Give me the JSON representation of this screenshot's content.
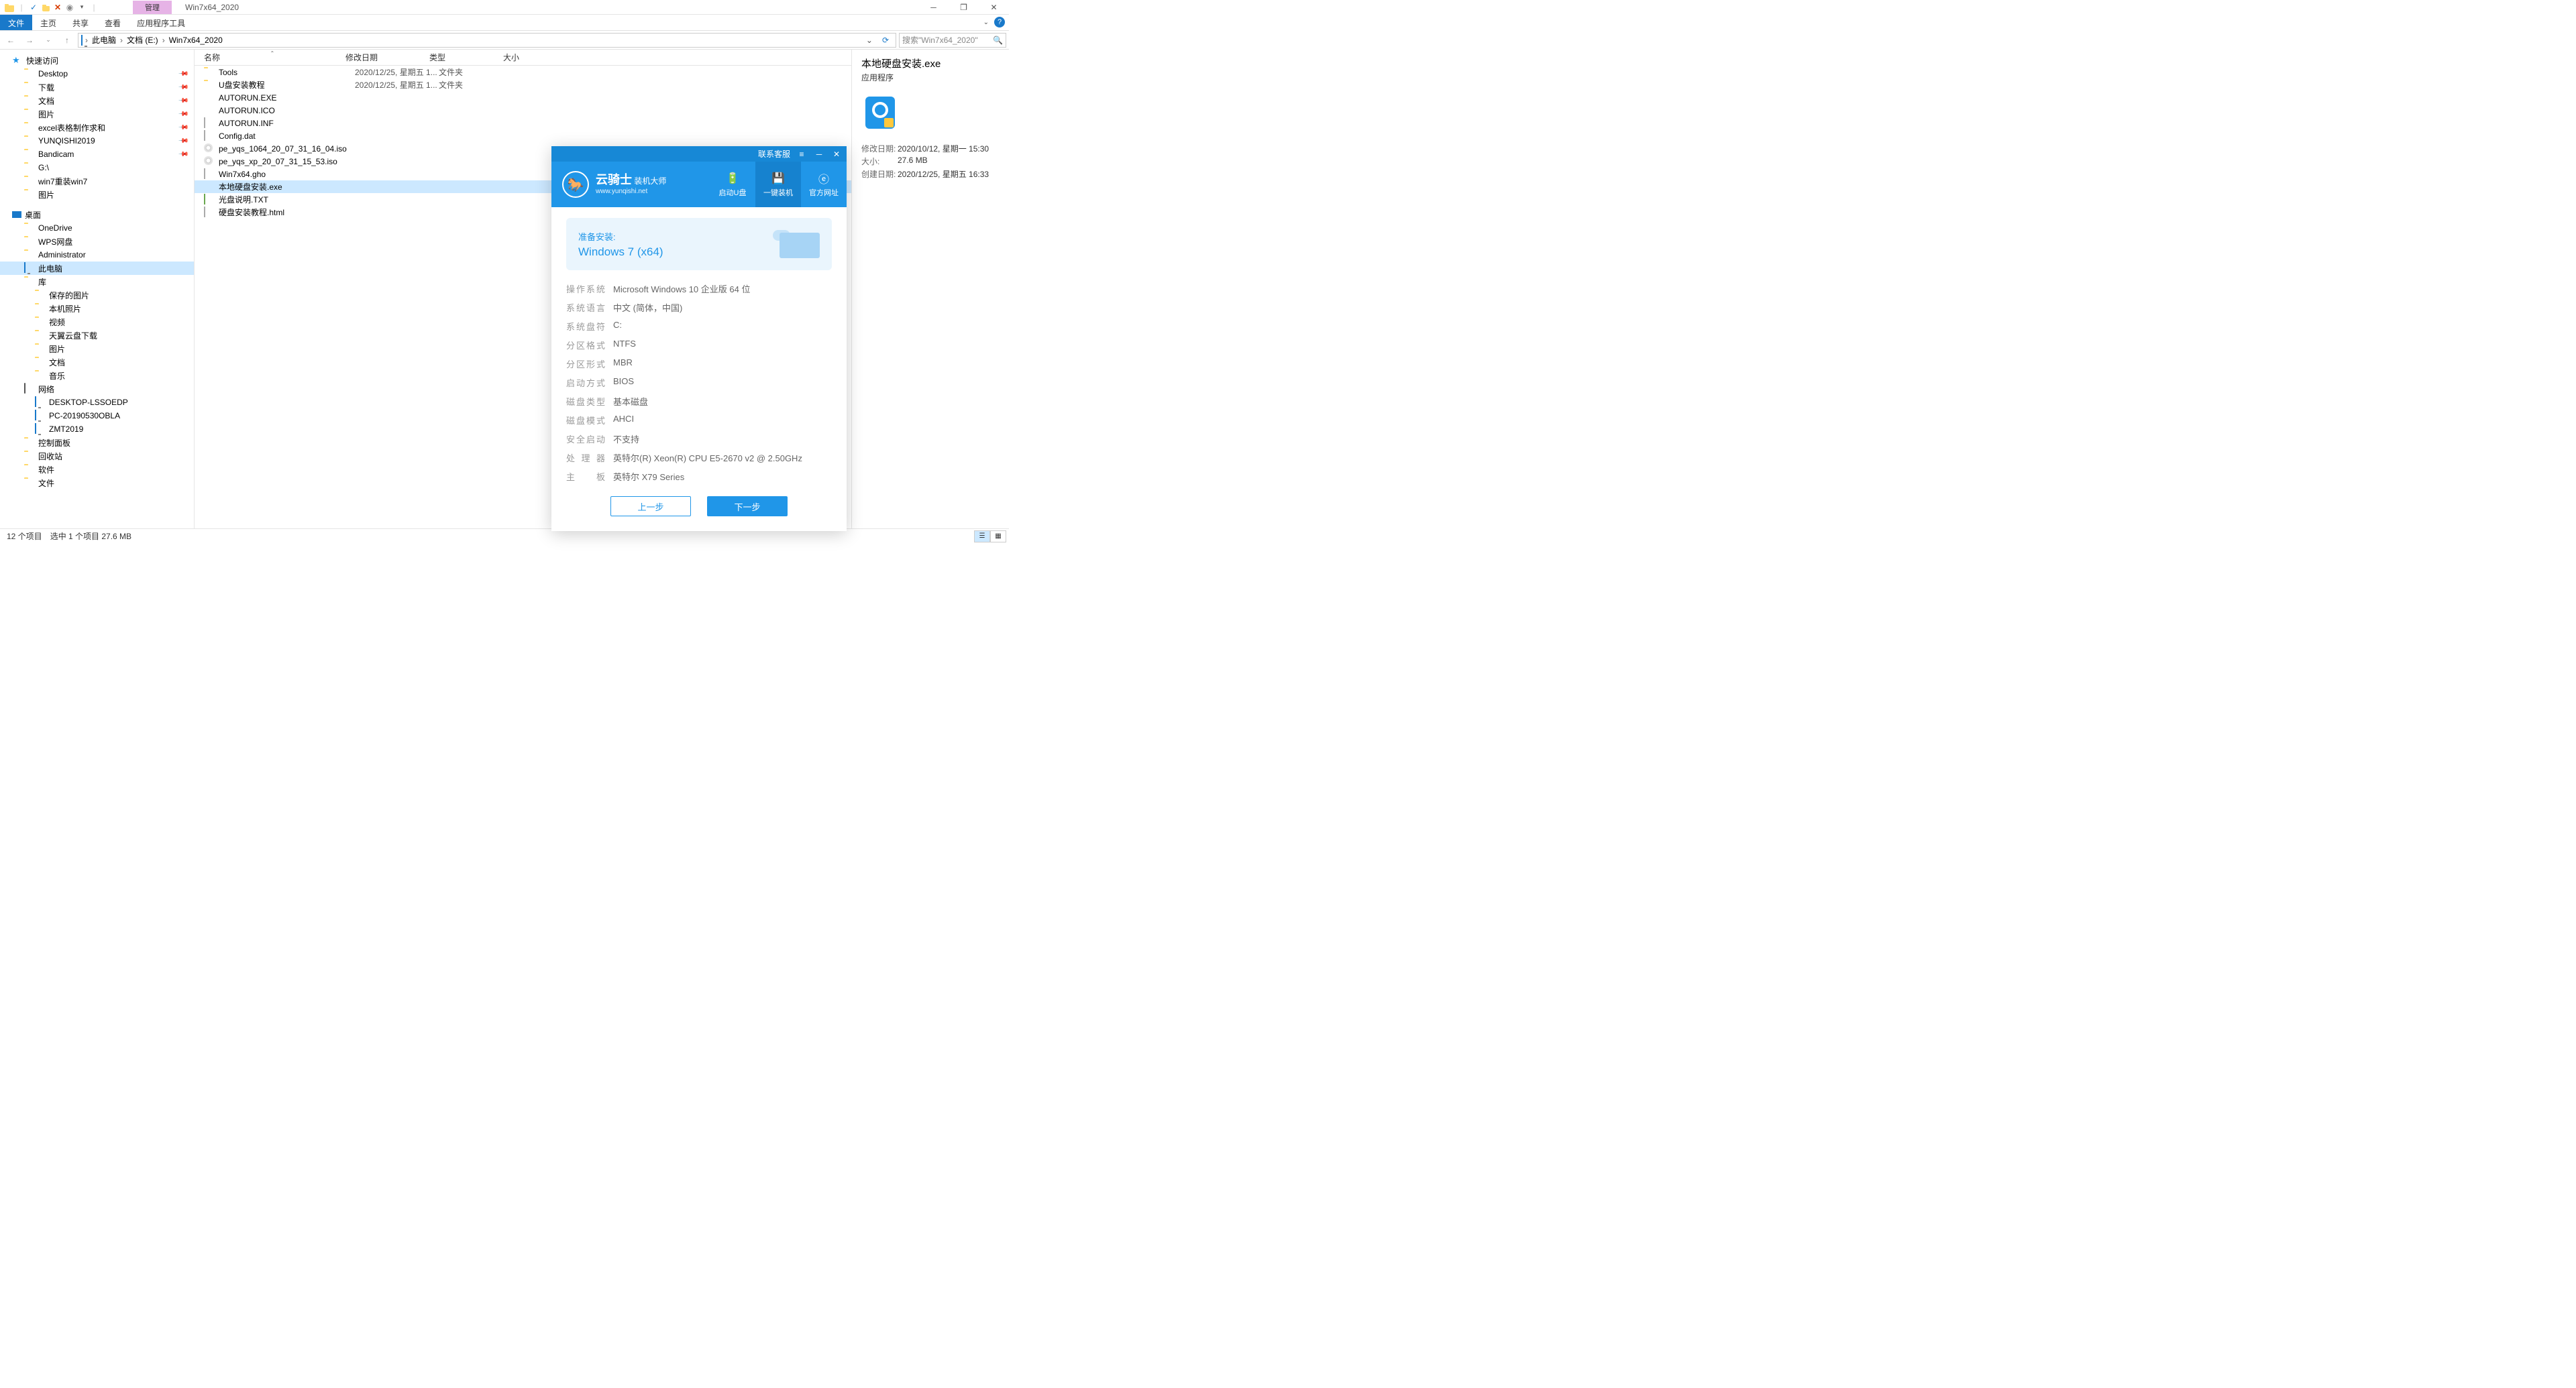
{
  "window": {
    "title": "Win7x64_2020",
    "context_tab": "管理"
  },
  "ribbon": {
    "file": "文件",
    "tabs": [
      "主页",
      "共享",
      "查看",
      "应用程序工具"
    ]
  },
  "breadcrumb": [
    "此电脑",
    "文档 (E:)",
    "Win7x64_2020"
  ],
  "search_placeholder": "搜索\"Win7x64_2020\"",
  "nav": {
    "quick": {
      "label": "快速访问",
      "items": [
        "Desktop",
        "下载",
        "文档",
        "图片",
        "excel表格制作求和",
        "YUNQISHI2019",
        "Bandicam",
        "G:\\",
        "win7重装win7",
        "图片"
      ]
    },
    "desktop": {
      "label": "桌面",
      "items": [
        "OneDrive",
        "WPS网盘",
        "Administrator",
        "此电脑",
        "库",
        "网络",
        "控制面板",
        "回收站",
        "软件",
        "文件"
      ]
    },
    "libs": [
      "保存的图片",
      "本机照片",
      "视频",
      "天翼云盘下载",
      "图片",
      "文档",
      "音乐"
    ],
    "net": [
      "DESKTOP-LSSOEDP",
      "PC-20190530OBLA",
      "ZMT2019"
    ],
    "selected": "此电脑"
  },
  "columns": {
    "name": "名称",
    "date": "修改日期",
    "type": "类型",
    "size": "大小"
  },
  "files": [
    {
      "name": "Tools",
      "date": "2020/12/25, 星期五 1...",
      "type": "文件夹",
      "kind": "folder"
    },
    {
      "name": "U盘安装教程",
      "date": "2020/12/25, 星期五 1...",
      "type": "文件夹",
      "kind": "folder"
    },
    {
      "name": "AUTORUN.EXE",
      "date": "",
      "type": "",
      "kind": "exe2"
    },
    {
      "name": "AUTORUN.ICO",
      "date": "",
      "type": "",
      "kind": "ico"
    },
    {
      "name": "AUTORUN.INF",
      "date": "",
      "type": "",
      "kind": "file"
    },
    {
      "name": "Config.dat",
      "date": "",
      "type": "",
      "kind": "file"
    },
    {
      "name": "pe_yqs_1064_20_07_31_16_04.iso",
      "date": "",
      "type": "",
      "kind": "disc"
    },
    {
      "name": "pe_yqs_xp_20_07_31_15_53.iso",
      "date": "",
      "type": "",
      "kind": "disc"
    },
    {
      "name": "Win7x64.gho",
      "date": "",
      "type": "",
      "kind": "file"
    },
    {
      "name": "本地硬盘安装.exe",
      "date": "",
      "type": "",
      "kind": "exe",
      "selected": true
    },
    {
      "name": "光盘说明.TXT",
      "date": "",
      "type": "",
      "kind": "txt"
    },
    {
      "name": "硬盘安装教程.html",
      "date": "",
      "type": "",
      "kind": "file"
    }
  ],
  "details": {
    "title": "本地硬盘安装.exe",
    "subtitle": "应用程序",
    "meta": [
      {
        "label": "修改日期:",
        "value": "2020/10/12, 星期一 15:30"
      },
      {
        "label": "大小:",
        "value": "27.6 MB"
      },
      {
        "label": "创建日期:",
        "value": "2020/12/25, 星期五 16:33"
      }
    ]
  },
  "status": {
    "count": "12 个项目",
    "sel": "选中 1 个项目  27.6 MB"
  },
  "dialog": {
    "service": "联系客服",
    "brand": "云骑士",
    "brand_sub": "装机大师",
    "url": "www.yunqishi.net",
    "tabs": [
      {
        "label": "启动U盘"
      },
      {
        "label": "一键装机"
      },
      {
        "label": "官方网址"
      }
    ],
    "active_tab": 1,
    "banner": {
      "label": "准备安装:",
      "title": "Windows 7 (x64)"
    },
    "info": [
      {
        "label": "操作系统",
        "value": "Microsoft Windows 10 企业版 64 位"
      },
      {
        "label": "系统语言",
        "value": "中文 (简体，中国)"
      },
      {
        "label": "系统盘符",
        "value": "C:"
      },
      {
        "label": "分区格式",
        "value": "NTFS"
      },
      {
        "label": "分区形式",
        "value": "MBR"
      },
      {
        "label": "启动方式",
        "value": "BIOS"
      },
      {
        "label": "磁盘类型",
        "value": "基本磁盘"
      },
      {
        "label": "磁盘模式",
        "value": "AHCI"
      },
      {
        "label": "安全启动",
        "value": "不支持"
      },
      {
        "label": "处理器",
        "value": "英特尔(R) Xeon(R) CPU E5-2670 v2 @ 2.50GHz"
      },
      {
        "label": "主板",
        "value": "英特尔 X79 Series"
      }
    ],
    "btn_prev": "上一步",
    "btn_next": "下一步"
  }
}
